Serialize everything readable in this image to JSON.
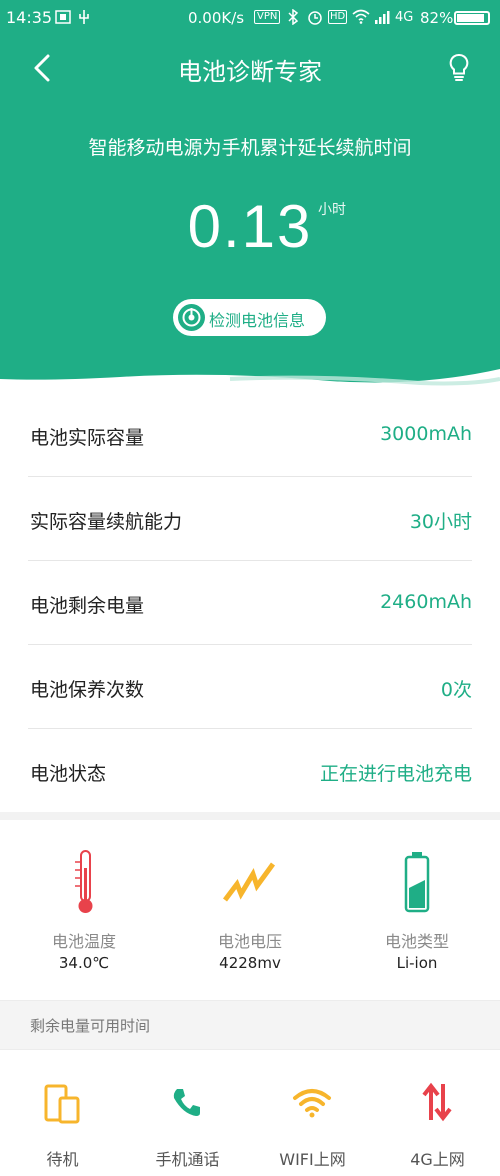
{
  "status_bar": {
    "time": "14:35",
    "speed": "0.00K/s",
    "vpn": "VPN",
    "hd": "HD",
    "network": "4G",
    "battery_percent": "82%"
  },
  "header": {
    "title": "电池诊断专家",
    "subtitle": "智能移动电源为手机累计延长续航时间",
    "extended_value": "0.13",
    "extended_unit": "小时",
    "detect_button": "检测电池信息"
  },
  "info_rows": [
    {
      "label": "电池实际容量",
      "value": "3000mAh"
    },
    {
      "label": "实际容量续航能力",
      "value": "30小时"
    },
    {
      "label": "电池剩余电量",
      "value": "2460mAh"
    },
    {
      "label": "电池保养次数",
      "value": "0次"
    },
    {
      "label": "电池状态",
      "value": "正在进行电池充电"
    }
  ],
  "stats": [
    {
      "label": "电池温度",
      "value": "34.0℃",
      "icon": "thermometer-icon"
    },
    {
      "label": "电池电压",
      "value": "4228mv",
      "icon": "lightning-icon"
    },
    {
      "label": "电池类型",
      "value": "Li-ion",
      "icon": "battery-icon"
    }
  ],
  "remaining_section_label": "剩余电量可用时间",
  "usage": [
    {
      "label": "待机",
      "icon": "standby-phone-icon"
    },
    {
      "label": "手机通话",
      "icon": "phone-call-icon"
    },
    {
      "label": "WIFI上网",
      "icon": "wifi-icon"
    },
    {
      "label": "4G上网",
      "icon": "data-transfer-icon"
    }
  ],
  "colors": {
    "brand": "#1fae86",
    "accent_orange": "#f7b52c",
    "alert_red": "#e8424b"
  }
}
